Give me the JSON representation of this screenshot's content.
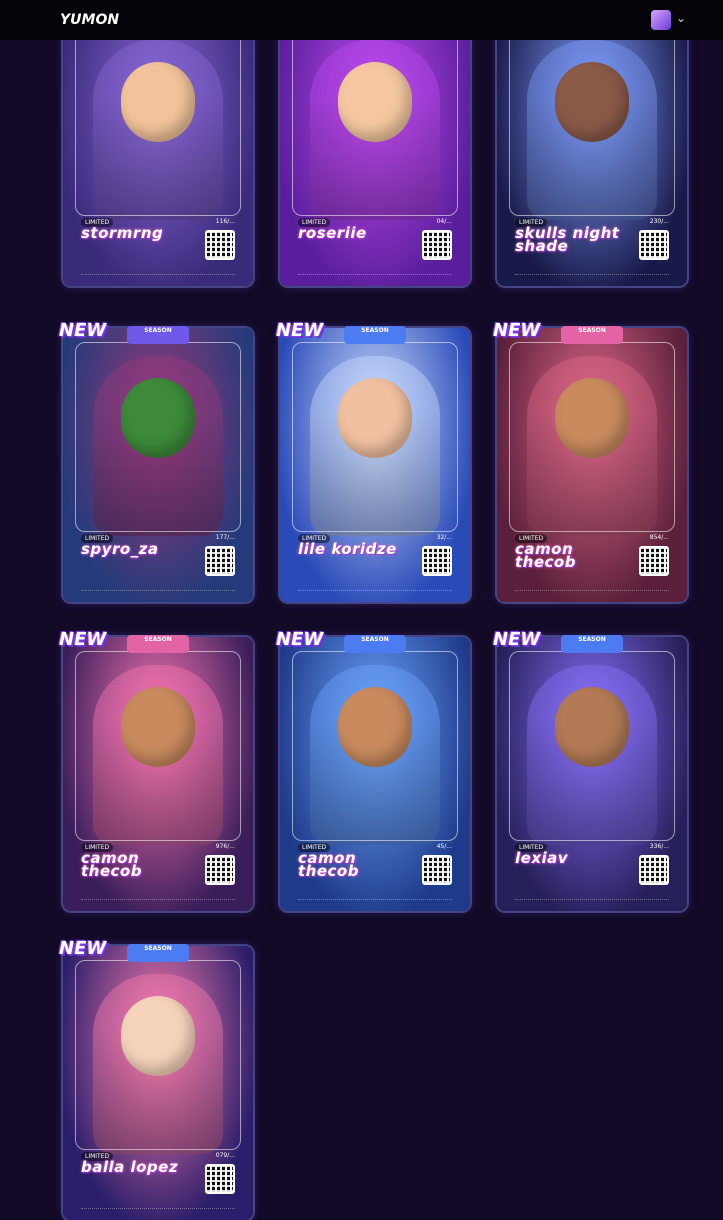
{
  "header": {
    "logo": "YUMON",
    "avatar_icon": "user-avatar-icon",
    "menu_icon": "chevron-down-icon"
  },
  "badges": {
    "new": "NEW",
    "season": "SEASON"
  },
  "cards": [
    {
      "name": "stormrng",
      "limited": "LIMITED",
      "number": "116/...",
      "colors": [
        "#3a2a7a",
        "#8b6ad8"
      ],
      "skin": "#f2c39a"
    },
    {
      "name": "roseriie",
      "limited": "LIMITED",
      "number": "04/...",
      "colors": [
        "#5a1e9c",
        "#c04cf0"
      ],
      "skin": "#f4c7a0"
    },
    {
      "name": "skulls night shade",
      "limited": "LIMITED",
      "number": "230/...",
      "colors": [
        "#1a1a4a",
        "#7fa0ff"
      ],
      "skin": "#8a5a48"
    },
    {
      "name": "spyro_za",
      "limited": "LIMITED",
      "number": "177/...",
      "colors": [
        "#243a7a",
        "#9a3a7a"
      ],
      "skin": "#3c8a3a",
      "new": true,
      "season": true,
      "season_color": "#6f59e8"
    },
    {
      "name": "lile koridze",
      "limited": "LIMITED",
      "number": "32/...",
      "colors": [
        "#2a4ab8",
        "#cfe0ff"
      ],
      "skin": "#f0c0a0",
      "new": true,
      "season": true,
      "season_color": "#4d7bf2"
    },
    {
      "name": "camon thecob",
      "limited": "LIMITED",
      "number": "854/...",
      "colors": [
        "#5a1f3a",
        "#e26a8a"
      ],
      "skin": "#c98a5e",
      "new": true,
      "season": true,
      "season_color": "#e264a4"
    },
    {
      "name": "camon thecob",
      "limited": "LIMITED",
      "number": "976/...",
      "colors": [
        "#3a1e5a",
        "#ff79b5"
      ],
      "skin": "#c98a5e",
      "new": true,
      "season": true,
      "season_color": "#e264a4"
    },
    {
      "name": "camon thecob",
      "limited": "LIMITED",
      "number": "45/...",
      "colors": [
        "#1e3a8a",
        "#6fa8ff"
      ],
      "skin": "#c98a5e",
      "new": true,
      "season": true,
      "season_color": "#4d7bf2"
    },
    {
      "name": "lexiav",
      "limited": "LIMITED",
      "number": "336/...",
      "colors": [
        "#26205a",
        "#8b72ff"
      ],
      "skin": "#b27a55",
      "new": true,
      "season": true,
      "season_color": "#4d7bf2"
    },
    {
      "name": "balla lopez",
      "limited": "LIMITED",
      "number": "079/...",
      "colors": [
        "#2a1e6a",
        "#ff7fb0"
      ],
      "skin": "#f6d3bb",
      "new": true,
      "season": true,
      "season_color": "#4d7bf2"
    }
  ]
}
